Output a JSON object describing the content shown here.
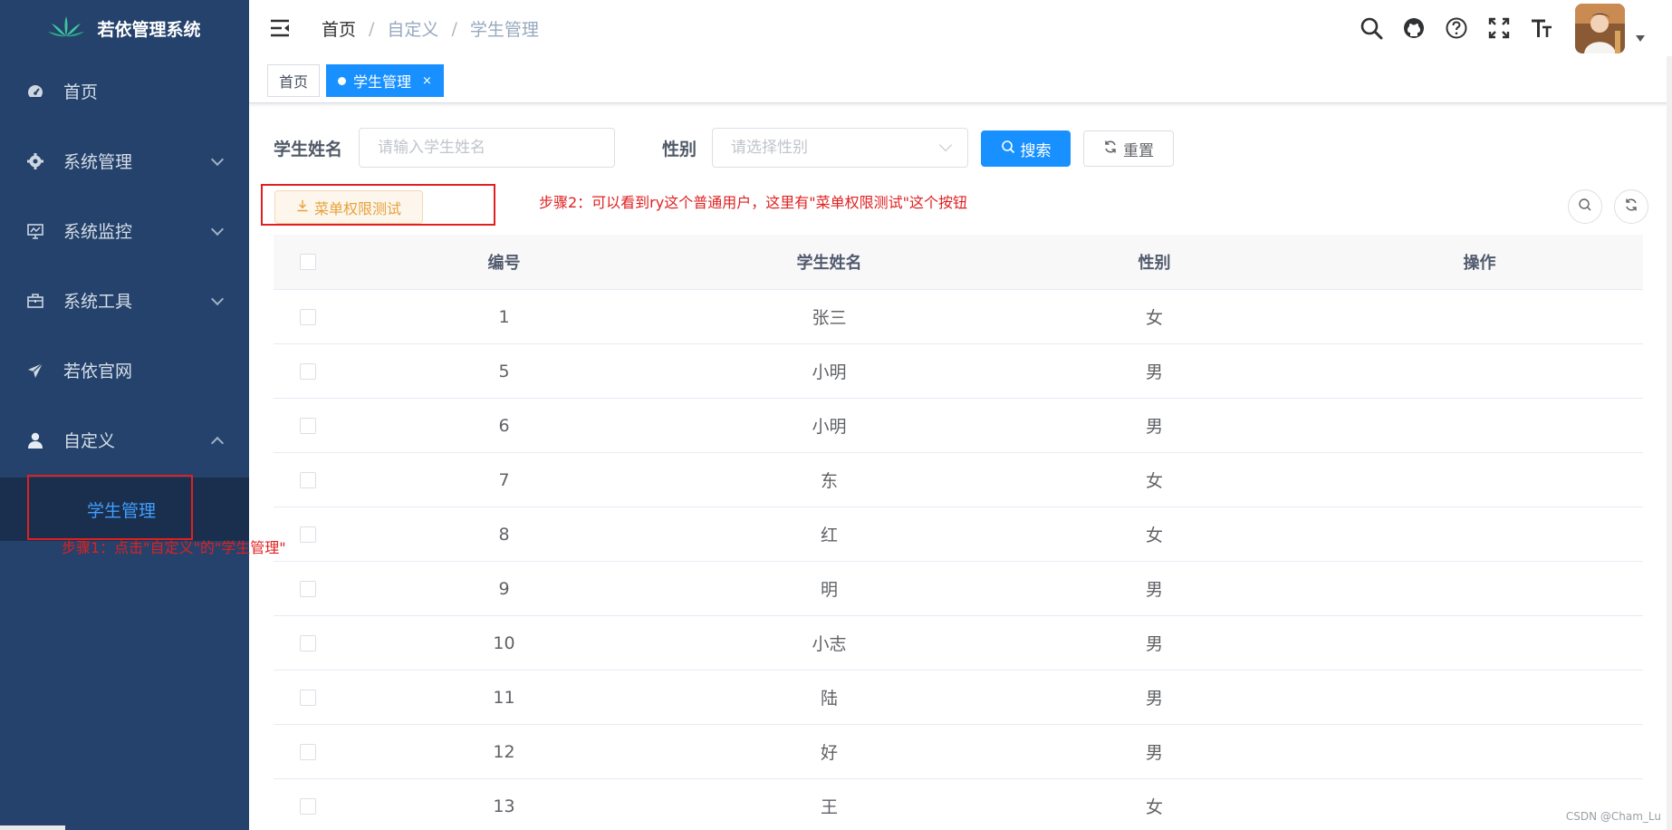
{
  "sidebar": {
    "logo_title": "若依管理系统",
    "menu": [
      {
        "label": "首页",
        "icon": "dashboard-icon"
      },
      {
        "label": "系统管理",
        "icon": "gear-icon"
      },
      {
        "label": "系统监控",
        "icon": "monitor-icon"
      },
      {
        "label": "系统工具",
        "icon": "toolbox-icon"
      },
      {
        "label": "若依官网",
        "icon": "paper-plane-icon"
      },
      {
        "label": "自定义",
        "icon": "user-icon"
      }
    ],
    "submenu_active": "学生管理"
  },
  "header": {
    "breadcrumb": [
      "首页",
      "自定义",
      "学生管理"
    ],
    "separator": "/"
  },
  "tags": {
    "home": "首页",
    "active": "学生管理",
    "close": "×"
  },
  "search_form": {
    "name_label": "学生姓名",
    "name_placeholder": "请输入学生姓名",
    "gender_label": "性别",
    "gender_placeholder": "请选择性别",
    "search_btn": "搜索",
    "reset_btn": "重置"
  },
  "toolbar": {
    "test_btn": "菜单权限测试"
  },
  "annotations": {
    "step1": "步骤1：点击\"自定义\"的\"学生管理\"",
    "step2": "步骤2：可以看到ry这个普通用户，这里有\"菜单权限测试\"这个按钮"
  },
  "table": {
    "headers": [
      "编号",
      "学生姓名",
      "性别",
      "操作"
    ],
    "rows": [
      {
        "id": "1",
        "name": "张三",
        "gender": "女"
      },
      {
        "id": "5",
        "name": "小明",
        "gender": "男"
      },
      {
        "id": "6",
        "name": "小明",
        "gender": "男"
      },
      {
        "id": "7",
        "name": "东",
        "gender": "女"
      },
      {
        "id": "8",
        "name": "红",
        "gender": "女"
      },
      {
        "id": "9",
        "name": "明",
        "gender": "男"
      },
      {
        "id": "10",
        "name": "小志",
        "gender": "男"
      },
      {
        "id": "11",
        "name": "陆",
        "gender": "男"
      },
      {
        "id": "12",
        "name": "好",
        "gender": "男"
      },
      {
        "id": "13",
        "name": "王",
        "gender": "女"
      }
    ]
  },
  "watermark": "CSDN @Cham_Lu",
  "colors": {
    "sidebar_bg": "#24426b",
    "primary": "#1890ff",
    "warning": "#e6a23c",
    "annotation": "#e02020"
  }
}
